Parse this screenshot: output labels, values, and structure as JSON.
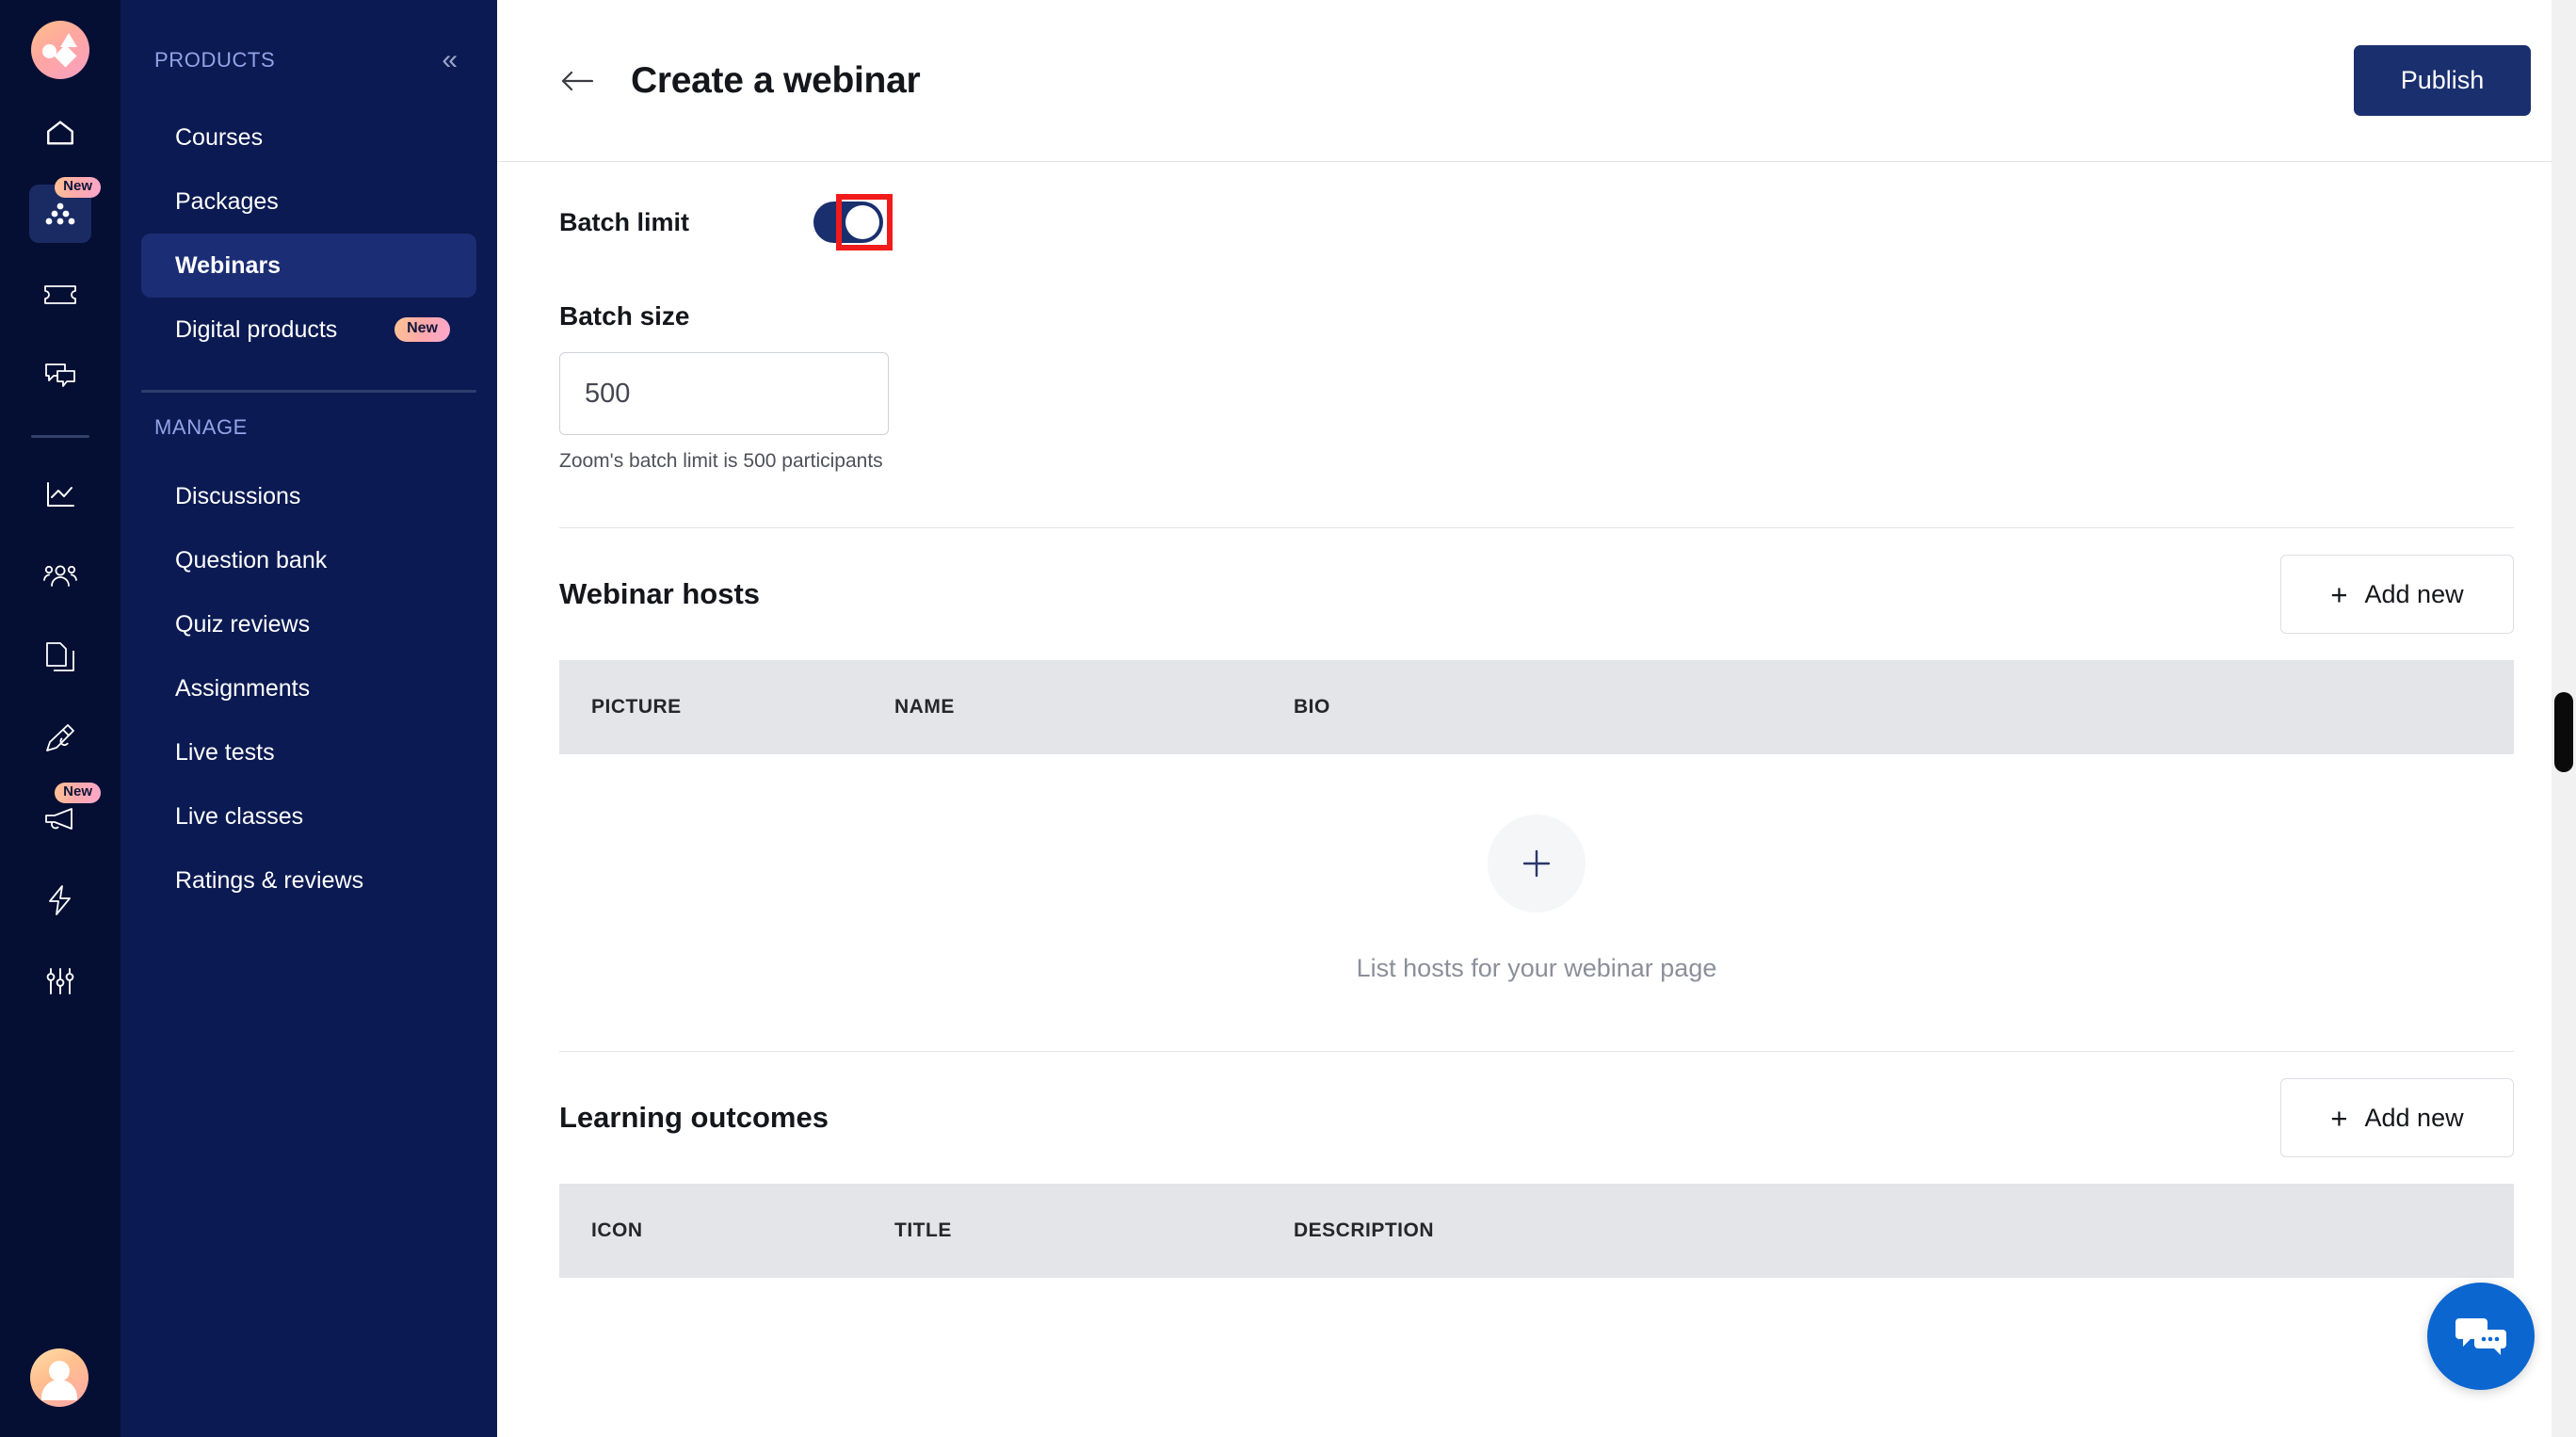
{
  "rail": {
    "logo_name": "graphy-logo",
    "items": [
      {
        "icon": "home-icon",
        "badge": null,
        "active": false
      },
      {
        "icon": "products-icon",
        "badge": "New",
        "active": true
      },
      {
        "icon": "ticket-icon",
        "badge": null,
        "active": false
      },
      {
        "icon": "chat-bubbles-icon",
        "badge": null,
        "active": false
      },
      {
        "icon": "analytics-chart-icon",
        "badge": null,
        "active": false
      },
      {
        "icon": "users-icon",
        "badge": null,
        "active": false
      },
      {
        "icon": "pages-copy-icon",
        "badge": null,
        "active": false
      },
      {
        "icon": "pen-edit-icon",
        "badge": null,
        "active": false
      },
      {
        "icon": "megaphone-icon",
        "badge": "New",
        "active": false
      },
      {
        "icon": "lightning-bolt-icon",
        "badge": null,
        "active": false
      },
      {
        "icon": "sliders-settings-icon",
        "badge": null,
        "active": false
      }
    ],
    "avatar_name": "user-avatar"
  },
  "sidebar": {
    "products_title": "PRODUCTS",
    "collapse_glyph": "«",
    "products": [
      {
        "label": "Courses",
        "badge": null,
        "active": false
      },
      {
        "label": "Packages",
        "badge": null,
        "active": false
      },
      {
        "label": "Webinars",
        "badge": null,
        "active": true
      },
      {
        "label": "Digital products",
        "badge": "New",
        "active": false
      }
    ],
    "manage_title": "MANAGE",
    "manage": [
      {
        "label": "Discussions"
      },
      {
        "label": "Question bank"
      },
      {
        "label": "Quiz reviews"
      },
      {
        "label": "Assignments"
      },
      {
        "label": "Live tests"
      },
      {
        "label": "Live classes"
      },
      {
        "label": "Ratings & reviews"
      }
    ]
  },
  "header": {
    "back_icon": "back-arrow-icon",
    "title": "Create a webinar",
    "publish_label": "Publish"
  },
  "batch_limit": {
    "label": "Batch limit",
    "toggle_on": true,
    "highlight_color": "#f21b1b"
  },
  "batch_size": {
    "label": "Batch size",
    "value": "500",
    "placeholder": "500",
    "helper": "Zoom's batch limit is 500 participants"
  },
  "webinar_hosts": {
    "title": "Webinar hosts",
    "add_label": "Add new",
    "add_glyph": "+",
    "columns": [
      "PICTURE",
      "NAME",
      "BIO"
    ],
    "rows": [],
    "empty_text": "List hosts for your webinar page",
    "empty_glyph": "+"
  },
  "learning_outcomes": {
    "title": "Learning outcomes",
    "add_label": "Add new",
    "add_glyph": "+",
    "columns": [
      "ICON",
      "TITLE",
      "DESCRIPTION"
    ],
    "rows": []
  },
  "chat_widget": {
    "icon": "chat-support-icon",
    "color": "#0b66d0"
  },
  "colors": {
    "rail_bg": "#050f33",
    "nav_bg": "#0b1a52",
    "nav_active": "#1b2d74",
    "accent_navy": "#1a2f6e",
    "table_head": "#e4e5e8"
  }
}
